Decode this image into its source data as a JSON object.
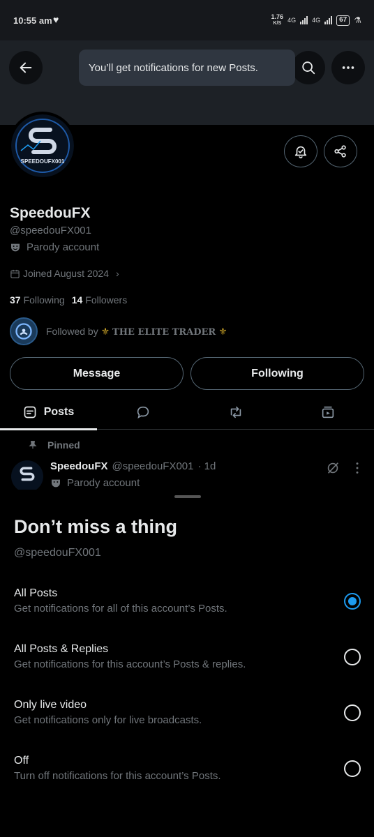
{
  "status_bar": {
    "time": "10:55 am",
    "speed_value": "1.76",
    "speed_unit": "K/S",
    "net1": "4G",
    "net2": "4G",
    "battery": "67"
  },
  "toast": {
    "text": "You’ll get notifications for new Posts."
  },
  "profile": {
    "name": "SpeedouFX",
    "handle": "@speedouFX001",
    "parody_label": "Parody account",
    "joined": "Joined August 2024",
    "following_count": "37",
    "following_label": "Following",
    "followers_count": "14",
    "followers_label": "Followers",
    "followed_by_prefix": "Followed by",
    "followed_by_name": "THE ELITE TRADER",
    "avatar_text": "SPEEDOUFX001"
  },
  "actions": {
    "message": "Message",
    "following": "Following"
  },
  "tabs": {
    "posts": "Posts"
  },
  "post": {
    "pinned_label": "Pinned",
    "author": "SpeedouFX",
    "handle": "@speedouFX001",
    "time": "· 1d",
    "parody_label": "Parody account"
  },
  "sheet": {
    "title": "Don’t miss a thing",
    "handle": "@speedouFX001",
    "options": [
      {
        "title": "All Posts",
        "subtitle": "Get notifications for all of this account’s Posts.",
        "selected": true
      },
      {
        "title": "All Posts & Replies",
        "subtitle": "Get notifications for this account’s Posts & replies.",
        "selected": false
      },
      {
        "title": "Only live video",
        "subtitle": "Get notifications only for live broadcasts.",
        "selected": false
      },
      {
        "title": "Off",
        "subtitle": "Turn off notifications for this account’s Posts.",
        "selected": false
      }
    ]
  },
  "colors": {
    "accent": "#1d9bf0",
    "muted": "#71767b",
    "toast_bg": "#2f3640"
  }
}
